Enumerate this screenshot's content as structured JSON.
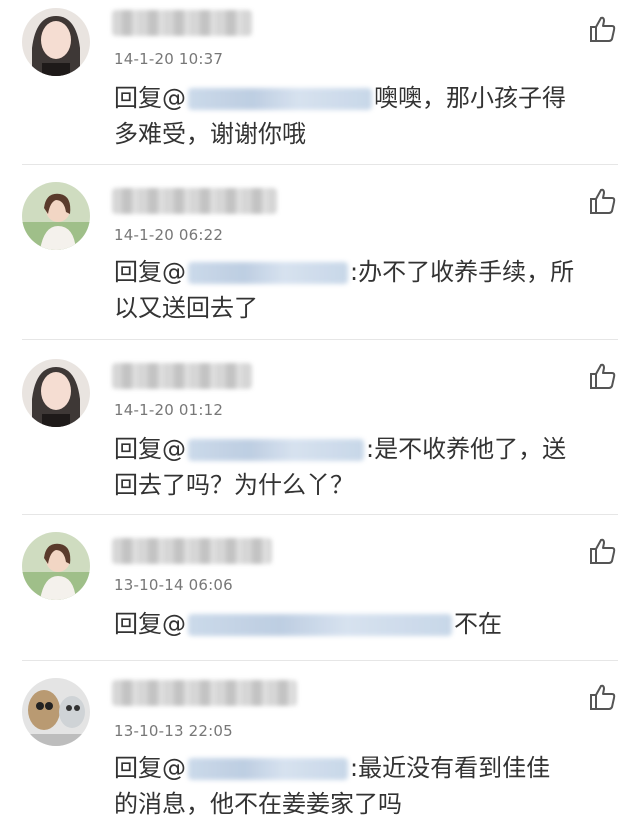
{
  "comments": [
    {
      "time": "14-1-20 10:37",
      "prefix": "回复@",
      "text_line1": "噢噢，那小孩子得",
      "text_line2": "多难受，谢谢你哦"
    },
    {
      "time": "14-1-20 06:22",
      "prefix": "回复@",
      "text_line1": ":办不了收养手续，所",
      "text_line2": "以又送回去了"
    },
    {
      "time": "14-1-20 01:12",
      "prefix": "回复@",
      "text_line1": ":是不收养他了，送",
      "text_line2": "回去了吗？为什么丫？"
    },
    {
      "time": "13-10-14 06:06",
      "prefix": "回复@",
      "text_line1": "不在",
      "text_line2": ""
    },
    {
      "time": "13-10-13 22:05",
      "prefix": "回复@",
      "text_line1": ":最近没有看到佳佳",
      "text_line2": "的消息，他不在姜姜家了吗"
    }
  ],
  "icons": {
    "like": "thumbs-up-icon",
    "avatar_a": "avatar-woman-portrait",
    "avatar_b": "avatar-woman-outdoor",
    "avatar_c": "avatar-cartoon"
  }
}
